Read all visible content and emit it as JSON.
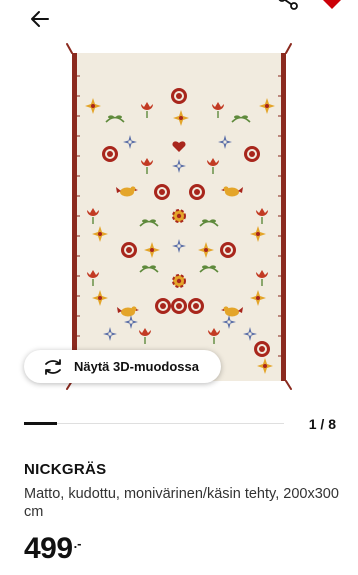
{
  "gallery": {
    "view_3d_label": "Näytä 3D-muodossa",
    "current_index": 1,
    "total_images": 8,
    "counter_text": "1 / 8"
  },
  "product": {
    "name": "NICKGRÄS",
    "description": "Matto, kudottu, monivärinen/käsin tehty, 200x300 cm",
    "price_integer": "499",
    "price_suffix": ".-"
  },
  "icons": {
    "back": "arrow-left-icon",
    "share": "share-icon",
    "favourite": "heart-icon",
    "view_3d": "rotate-3d-icon"
  },
  "colors": {
    "rug_background": "#f1ebdf",
    "rug_border": "#8b2a1f",
    "favourite": "#cc0008",
    "flower_red": "#a8261c",
    "flower_yellow": "#e4a52a",
    "flower_blue": "#5b6fa8",
    "leaf_green": "#5f8a3c"
  }
}
